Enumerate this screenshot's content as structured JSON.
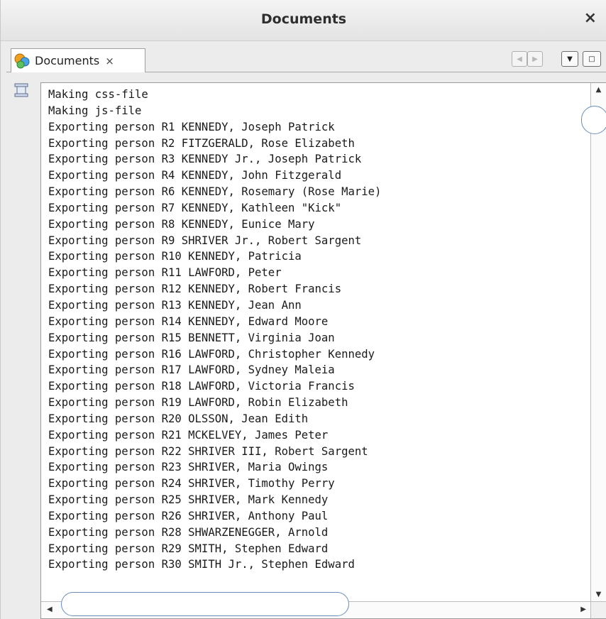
{
  "window": {
    "title": "Documents",
    "close_glyph": "×"
  },
  "tab": {
    "label": "Documents",
    "close_glyph": "×",
    "icon": "documents-icon"
  },
  "tab_controls": [
    {
      "name": "scroll-tabs-left-button",
      "glyph": "◀"
    },
    {
      "name": "scroll-tabs-right-button",
      "glyph": "▶"
    },
    {
      "name": "tab-list-dropdown-button",
      "glyph": "▼"
    },
    {
      "name": "maximize-button",
      "glyph": "□"
    }
  ],
  "gutter": {
    "icon": "pin-icon"
  },
  "log": [
    "Making css-file",
    "Making js-file",
    "Exporting person R1 KENNEDY, Joseph Patrick",
    "Exporting person R2 FITZGERALD, Rose Elizabeth",
    "Exporting person R3 KENNEDY Jr., Joseph Patrick",
    "Exporting person R4 KENNEDY, John Fitzgerald",
    "Exporting person R6 KENNEDY, Rosemary (Rose Marie)",
    "Exporting person R7 KENNEDY, Kathleen \"Kick\"",
    "Exporting person R8 KENNEDY, Eunice Mary",
    "Exporting person R9 SHRIVER Jr., Robert Sargent",
    "Exporting person R10 KENNEDY, Patricia",
    "Exporting person R11 LAWFORD, Peter",
    "Exporting person R12 KENNEDY, Robert Francis",
    "Exporting person R13 KENNEDY, Jean Ann",
    "Exporting person R14 KENNEDY, Edward Moore",
    "Exporting person R15 BENNETT, Virginia Joan",
    "Exporting person R16 LAWFORD, Christopher Kennedy",
    "Exporting person R17 LAWFORD, Sydney Maleia",
    "Exporting person R18 LAWFORD, Victoria Francis",
    "Exporting person R19 LAWFORD, Robin Elizabeth",
    "Exporting person R20 OLSSON, Jean Edith",
    "Exporting person R21 MCKELVEY, James Peter",
    "Exporting person R22 SHRIVER III, Robert Sargent",
    "Exporting person R23 SHRIVER, Maria Owings",
    "Exporting person R24 SHRIVER, Timothy Perry",
    "Exporting person R25 SHRIVER, Mark Kennedy",
    "Exporting person R26 SHRIVER, Anthony Paul",
    "Exporting person R28 SHWARZENEGGER, Arnold",
    "Exporting person R29 SMITH, Stephen Edward",
    "Exporting person R30 SMITH Jr., Stephen Edward"
  ],
  "scrollbars": {
    "up_glyph": "▲",
    "down_glyph": "▼",
    "left_glyph": "◀",
    "right_glyph": "▶"
  }
}
